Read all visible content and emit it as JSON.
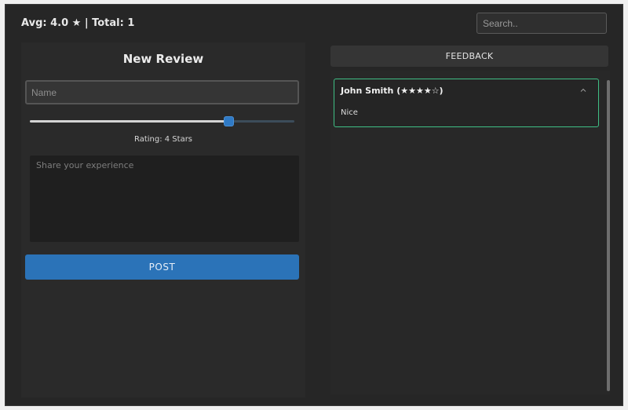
{
  "header": {
    "stats": "Avg: 4.0 ★ | Total: 1",
    "search_placeholder": "Search.."
  },
  "form": {
    "title": "New Review",
    "name_placeholder": "Name",
    "rating_value": 4,
    "rating_max": 5,
    "rating_label": "Rating: 4 Stars",
    "experience_placeholder": "Share your experience",
    "post_label": "POST",
    "accent_color": "#2b73b8"
  },
  "feedback": {
    "header": "FEEDBACK",
    "reviews": [
      {
        "title": "John Smith (★★★★☆)",
        "text": "Nice",
        "border_color": "#3fbf85",
        "toggle_icon": "chevron-up-icon"
      }
    ]
  }
}
